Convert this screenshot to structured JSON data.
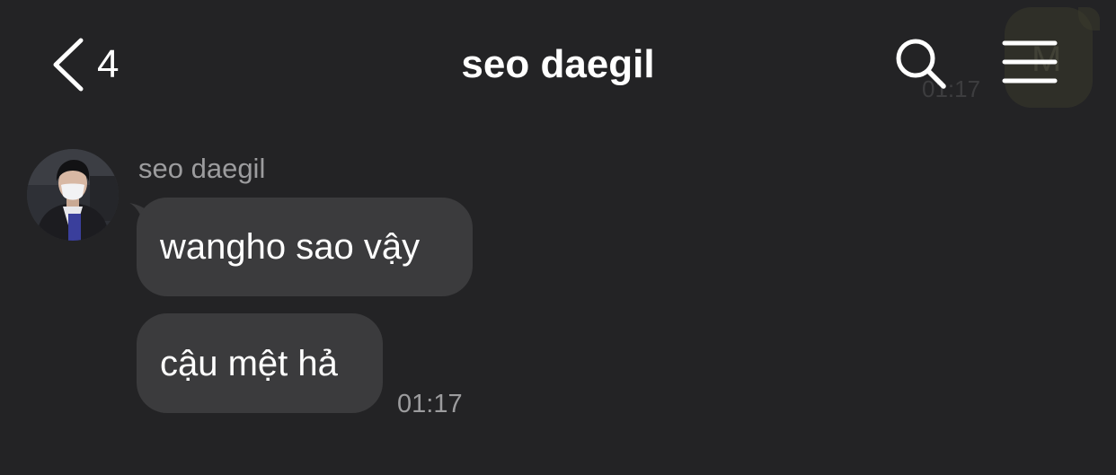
{
  "header": {
    "back_count": "4",
    "title": "seo daegil"
  },
  "background_peek": {
    "time": "01:17",
    "letter": "M"
  },
  "conversation": {
    "sender_name": "seo daegil",
    "messages": [
      {
        "text": "wangho sao vậy"
      },
      {
        "text": "cậu mệt hả"
      }
    ],
    "last_time": "01:17"
  },
  "icons": {
    "back": "chevron-left-icon",
    "search": "search-icon",
    "menu": "hamburger-menu-icon"
  },
  "colors": {
    "background": "#232325",
    "bubble": "#3b3b3d",
    "secondary_text": "#9c9c9e"
  }
}
